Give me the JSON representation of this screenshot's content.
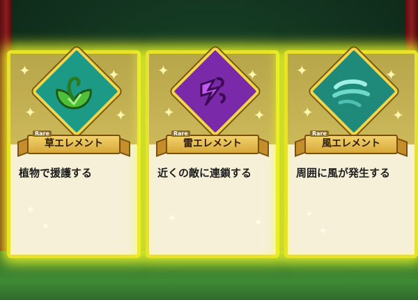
{
  "cards": [
    {
      "rarity": "Rare",
      "name": "草エレメント",
      "description": "植物で援護する",
      "element_icon": "leaf-icon",
      "icon_color": "#4fbf3a"
    },
    {
      "rarity": "Rare",
      "name": "雷エレメント",
      "description": "近くの敵に連鎖する",
      "element_icon": "lightning-icon",
      "icon_color": "#a23cc4"
    },
    {
      "rarity": "Rare",
      "name": "風エレメント",
      "description": "周囲に風が発生する",
      "element_icon": "wind-icon",
      "icon_color": "#5fd0c0"
    }
  ],
  "colors": {
    "glow": "#e9e22a",
    "card_bg": "#f6f0d8",
    "banner": "#e3b94d"
  }
}
